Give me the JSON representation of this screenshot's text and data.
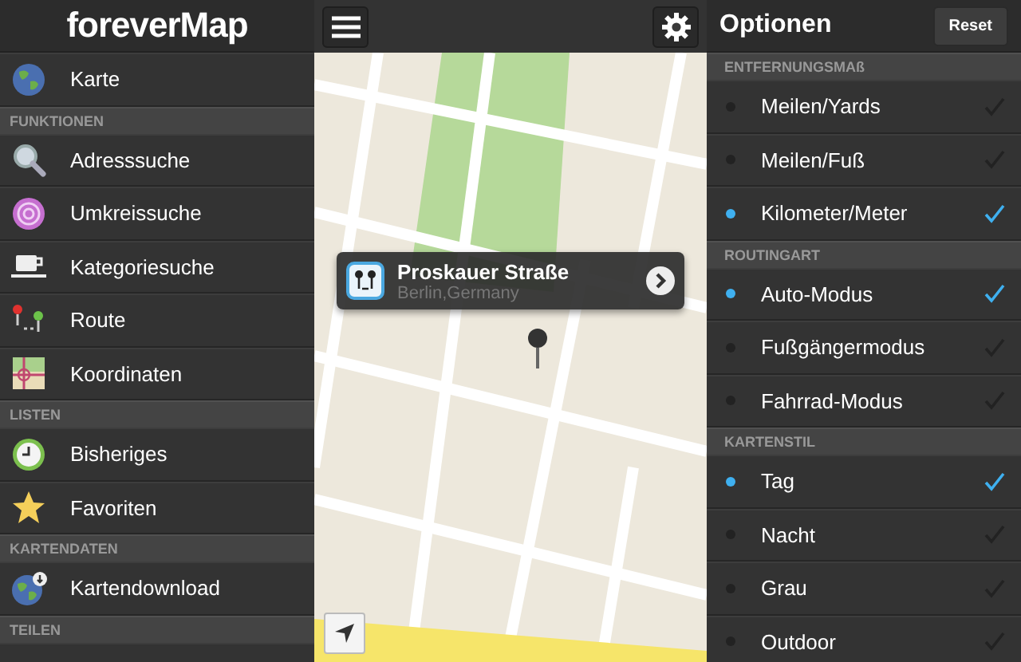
{
  "menu": {
    "logo": "foreverMap",
    "top_items": [
      {
        "label": "Karte"
      }
    ],
    "sections": [
      {
        "title": "FUNKTIONEN",
        "items": [
          {
            "label": "Adresssuche"
          },
          {
            "label": "Umkreissuche"
          },
          {
            "label": "Kategoriesuche"
          },
          {
            "label": "Route"
          },
          {
            "label": "Koordinaten"
          }
        ]
      },
      {
        "title": "LISTEN",
        "items": [
          {
            "label": "Bisheriges"
          },
          {
            "label": "Favoriten"
          }
        ]
      },
      {
        "title": "KARTENDATEN",
        "items": [
          {
            "label": "Kartendownload"
          }
        ]
      },
      {
        "title": "TEILEN"
      }
    ]
  },
  "map": {
    "callout": {
      "title": "Proskauer Straße",
      "subtitle": "Berlin,Germany"
    }
  },
  "options": {
    "title": "Optionen",
    "reset": "Reset",
    "sections": [
      {
        "title": "ENTFERNUNGSMAß",
        "items": [
          {
            "label": "Meilen/Yards",
            "selected": false
          },
          {
            "label": "Meilen/Fuß",
            "selected": false
          },
          {
            "label": "Kilometer/Meter",
            "selected": true
          }
        ]
      },
      {
        "title": "ROUTINGART",
        "items": [
          {
            "label": "Auto-Modus",
            "selected": true
          },
          {
            "label": "Fußgängermodus",
            "selected": false
          },
          {
            "label": "Fahrrad-Modus",
            "selected": false
          }
        ]
      },
      {
        "title": "KARTENSTIL",
        "items": [
          {
            "label": "Tag",
            "selected": true
          },
          {
            "label": "Nacht",
            "selected": false
          },
          {
            "label": "Grau",
            "selected": false
          },
          {
            "label": "Outdoor",
            "selected": false
          }
        ]
      }
    ]
  }
}
